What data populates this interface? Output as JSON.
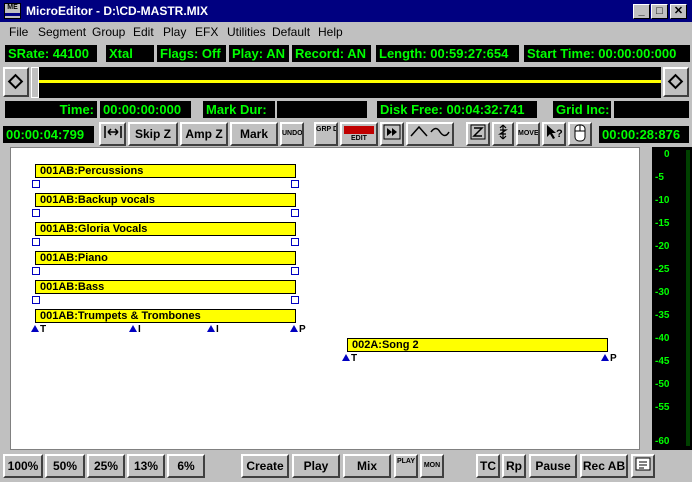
{
  "window": {
    "app_name": "MicroEditor",
    "title": "MicroEditor - D:\\CD-MASTR.MIX",
    "controls": [
      "_",
      "□",
      "✕"
    ]
  },
  "menu": [
    {
      "label": "File",
      "key": "F"
    },
    {
      "label": "Segment",
      "key": "S"
    },
    {
      "label": "Group",
      "key": "G"
    },
    {
      "label": "Edit",
      "key": "E"
    },
    {
      "label": "Play",
      "key": "P"
    },
    {
      "label": "EFX",
      "key": "X"
    },
    {
      "label": "Utilities",
      "key": "U"
    },
    {
      "label": "Default",
      "key": "D"
    },
    {
      "label": "Help",
      "key": "H"
    }
  ],
  "status": {
    "srate": "SRate: 44100",
    "clock": "Xtal",
    "flags": "Flags: Off",
    "play": "Play: AN",
    "record": "Record: AN",
    "length": "Length: 00:59:27:654",
    "start_time": "Start Time: 00:00:00:000"
  },
  "info": {
    "time_label": "Time:",
    "time_value": "00:00:00:000",
    "mark_dur_label": "Mark Dur:",
    "disk_free": "Disk Free: 00:04:32:741",
    "grid_inc_label": "Grid Inc:"
  },
  "toolbar": {
    "left_time": "00:00:04:799",
    "right_time": "00:00:28:876",
    "skip_z": "Skip Z",
    "amp_z": "Amp Z",
    "mark": "Mark",
    "undo": "UNDO",
    "grp_dis": "GRP DIS",
    "edit": "EDIT",
    "move": "MOVE"
  },
  "tracks": [
    {
      "label": "001AB:Percussions"
    },
    {
      "label": "001AB:Backup vocals"
    },
    {
      "label": "001AB:Gloria Vocals"
    },
    {
      "label": "001AB:Piano"
    },
    {
      "label": "001AB:Bass"
    },
    {
      "label": "001AB:Trumpets & Trombones"
    },
    {
      "label": "002A:Song 2"
    }
  ],
  "markers": {
    "t": "T",
    "i": "I",
    "p": "P"
  },
  "vu_meter": {
    "labels": [
      "0",
      "-5",
      "-10",
      "-15",
      "-20",
      "-25",
      "-30",
      "-35",
      "-40",
      "-45",
      "-50",
      "-55",
      "-60"
    ]
  },
  "bottom": {
    "zoom": [
      "100%",
      "50%",
      "25%",
      "13%",
      "6%"
    ],
    "create": "Create",
    "play": "Play",
    "mix": "Mix",
    "play_small": "PLAY",
    "mon": "MON",
    "tc": "TC",
    "rp": "Rp",
    "pause": "Pause",
    "rec_ab": "Rec AB"
  },
  "colors": {
    "lcd_green": "#00ff00",
    "segment_yellow": "#ffff00",
    "title_blue": "#000080"
  }
}
